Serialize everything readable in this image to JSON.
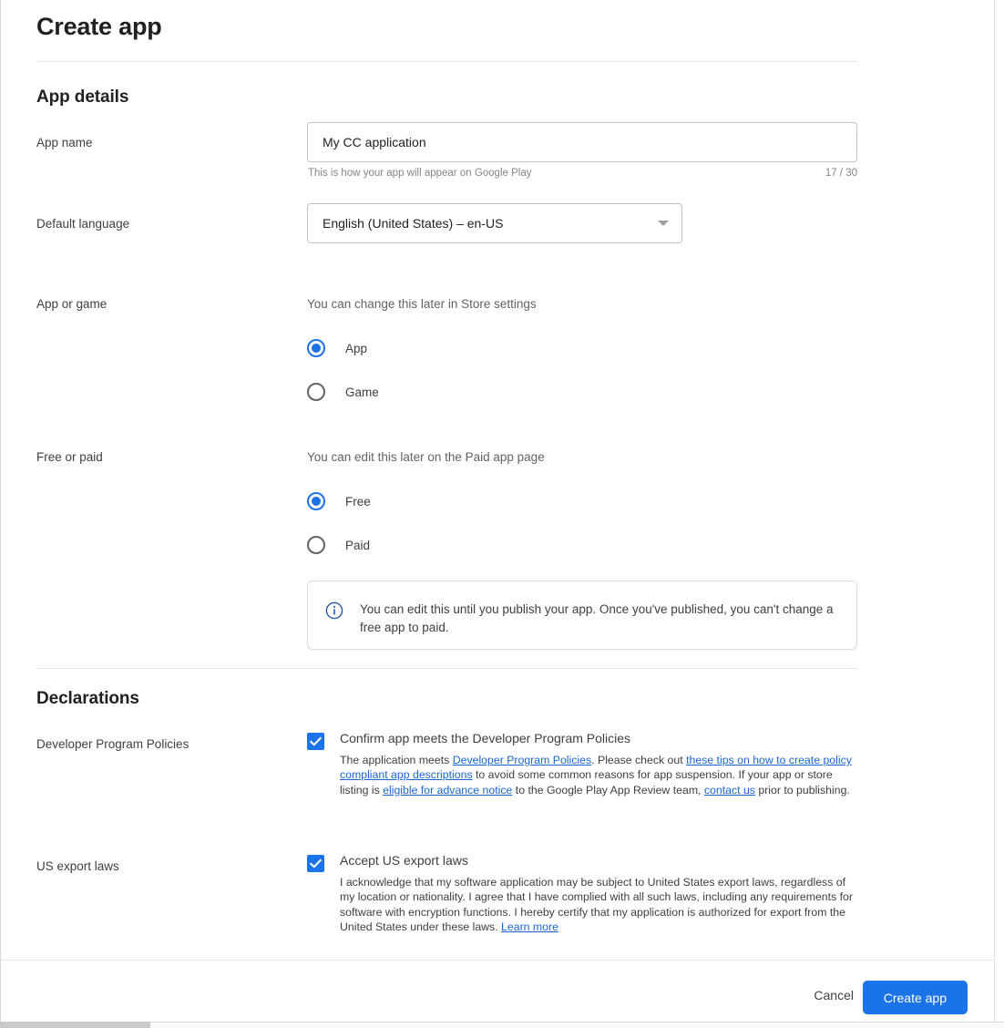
{
  "dialog": {
    "title": "Create app"
  },
  "sections": {
    "app_details": {
      "heading": "App details",
      "app_name": {
        "label": "App name",
        "value": "My CC application",
        "placeholder": "App name",
        "hint": "This is how your app will appear on Google Play",
        "counter": "17 / 30"
      },
      "default_language": {
        "label": "Default language",
        "value": "English (United States) – en-US",
        "arrow_icon": "chevron-down-icon"
      },
      "app_or_game": {
        "label": "App or game",
        "help": "You can change this later in Store settings",
        "options": [
          {
            "label": "App",
            "selected": true
          },
          {
            "label": "Game",
            "selected": false
          }
        ]
      },
      "free_or_paid": {
        "label": "Free or paid",
        "help": "You can edit this later on the Paid app page",
        "options": [
          {
            "label": "Free",
            "selected": true
          },
          {
            "label": "Paid",
            "selected": false
          }
        ],
        "callout": {
          "icon": "info-icon",
          "text": "You can edit this until you publish your app. Once you've published, you can't change a free app to paid."
        }
      }
    },
    "declarations": {
      "heading": "Declarations",
      "items": [
        {
          "label": "Developer Program Policies",
          "checkbox_title": "Confirm app meets the Developer Program Policies",
          "checked": true,
          "body_parts": [
            {
              "t": "The application meets ",
              "link": false
            },
            {
              "t": "Developer Program Policies",
              "link": true
            },
            {
              "t": ". Please check out ",
              "link": false
            },
            {
              "t": "these tips on how to create policy compliant app descriptions",
              "link": true
            },
            {
              "t": " to avoid some common reasons for app suspension. If your app or store listing is ",
              "link": false
            },
            {
              "t": "eligible for advance notice",
              "link": true
            },
            {
              "t": " to the Google Play App Review team, ",
              "link": false
            },
            {
              "t": "contact us",
              "link": true
            },
            {
              "t": " prior to publishing.",
              "link": false
            }
          ]
        },
        {
          "label": "US export laws",
          "checkbox_title": "Accept US export laws",
          "checked": true,
          "body_parts": [
            {
              "t": "I acknowledge that my software application may be subject to United States export laws, regardless of my location or nationality. I agree that I have complied with all such laws, including any requirements for software with encryption functions. I hereby certify that my application is authorized for export from the United States under these laws. ",
              "link": false
            },
            {
              "t": "Learn more",
              "link": true
            }
          ]
        }
      ]
    }
  },
  "footer": {
    "cancel_label": "Cancel",
    "create_label": "Create app"
  },
  "colors": {
    "accent": "#1a73e8",
    "link": "#1967d2",
    "text_primary": "#202124",
    "text_secondary": "#5f6368",
    "border": "#bdc1c6",
    "info_icon": "#174ea6"
  }
}
